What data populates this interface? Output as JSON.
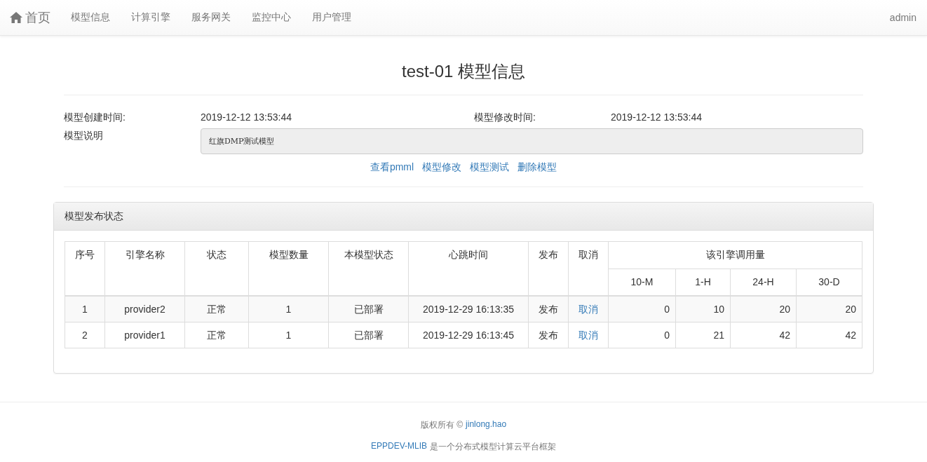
{
  "navbar": {
    "brand": "首页",
    "items": [
      "模型信息",
      "计算引擎",
      "服务网关",
      "监控中心",
      "用户管理"
    ],
    "user": "admin"
  },
  "title": "test-01 模型信息",
  "info": {
    "created_label": "模型创建时间:",
    "created": "2019-12-12 13:53:44",
    "modified_label": "模型修改时间:",
    "modified": "2019-12-12 13:53:44",
    "description_label": "模型说明",
    "description": "红旗DMP测试模型"
  },
  "actions": [
    "查看pmml",
    "模型修改",
    "模型测试",
    "删除模型"
  ],
  "panel": {
    "title": "模型发布状态",
    "table": {
      "columns": [
        "序号",
        "引擎名称",
        "状态",
        "模型数量",
        "本模型状态",
        "心跳时间",
        "发布",
        "取消"
      ],
      "group_heading": "该引擎调用量",
      "subcolumns": [
        "10-M",
        "1-H",
        "24-H",
        "30-D"
      ],
      "rows": [
        {
          "cells": [
            "1",
            "provider2",
            "正常",
            "1",
            "已部署",
            "2019-12-29 16:13:35",
            "发布"
          ],
          "cancel": "取消",
          "usage": [
            "0",
            "10",
            "20",
            "20"
          ]
        },
        {
          "cells": [
            "2",
            "provider1",
            "正常",
            "1",
            "已部署",
            "2019-12-29 16:13:45",
            "发布"
          ],
          "cancel": "取消",
          "usage": [
            "0",
            "21",
            "42",
            "42"
          ]
        }
      ]
    }
  },
  "footer": {
    "copyright": "版权所有 ©",
    "author": "jinlong.hao",
    "project": "EPPDEV-MLIB",
    "tagline": "是一个分布式模型计算云平台框架"
  }
}
